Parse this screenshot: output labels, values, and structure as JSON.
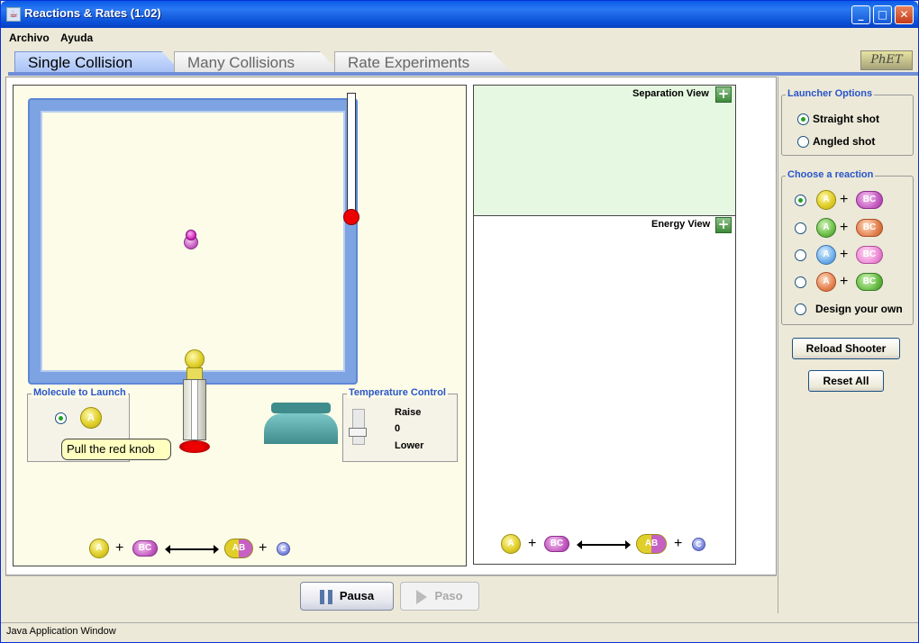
{
  "window": {
    "title": "Reactions & Rates (1.02)"
  },
  "menu": [
    "Archivo",
    "Ayuda"
  ],
  "tabs": [
    {
      "label": "Single Collision",
      "active": true
    },
    {
      "label": "Many Collisions",
      "active": false
    },
    {
      "label": "Rate Experiments",
      "active": false
    }
  ],
  "logo": {
    "text": "PhET"
  },
  "simulation": {
    "molecule_to_launch": {
      "title": "Molecule to Launch",
      "selected_molecule": "A"
    },
    "tooltip": "Pull the red knob",
    "temperature_control": {
      "title": "Temperature Control",
      "raise_label": "Raise",
      "value": "0",
      "lower_label": "Lower"
    },
    "equation": {
      "left": [
        "A",
        "BC"
      ],
      "right": [
        "AB",
        "C"
      ]
    }
  },
  "views": {
    "separation": {
      "label": "Separation View",
      "expand_icon": "+"
    },
    "energy": {
      "label": "Energy View",
      "expand_icon": "+"
    }
  },
  "sidebar": {
    "launcher_options": {
      "title": "Launcher Options",
      "options": [
        {
          "label": "Straight shot",
          "checked": true
        },
        {
          "label": "Angled shot",
          "checked": false
        }
      ]
    },
    "choose_reaction": {
      "title": "Choose a reaction",
      "options": [
        {
          "a": "A",
          "bc": "BC",
          "colors": "yellow-magenta",
          "checked": true
        },
        {
          "a": "A",
          "bc": "BC",
          "colors": "green-orange",
          "checked": false
        },
        {
          "a": "A",
          "bc": "BC",
          "colors": "blue-pink",
          "checked": false
        },
        {
          "a": "A",
          "bc": "BC",
          "colors": "orange-green",
          "checked": false
        }
      ],
      "custom_label": "Design your own"
    },
    "reload_button": "Reload Shooter",
    "reset_button": "Reset All"
  },
  "controls": {
    "pause_button": "Pausa",
    "step_button": "Paso"
  },
  "status": {
    "text": "Java Application Window"
  },
  "colors": {
    "titlebar": "#0a5ae8",
    "tab_active": "#a7c1f3",
    "box_border": "#7ea3e3",
    "separation_bg": "#e6f8e2",
    "thermo_bulb": "#e00000"
  }
}
